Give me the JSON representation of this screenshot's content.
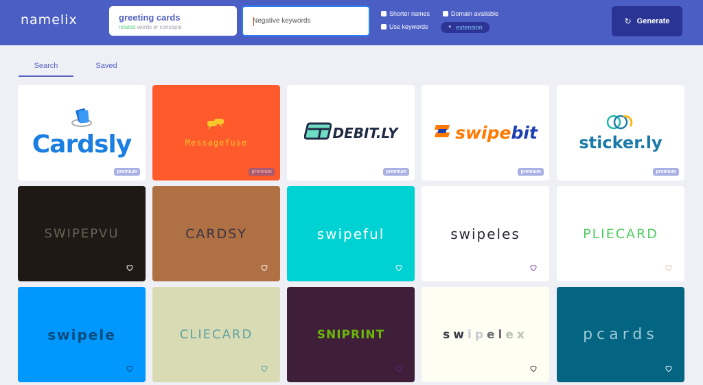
{
  "app": {
    "logo": "namelix",
    "accent_color": "#4b5ec4"
  },
  "search": {
    "keywords_value": "greeting cards",
    "keywords_hint_highlight": "related",
    "keywords_hint_rest": " words or concepts",
    "negative_placeholder": "Negative keywords",
    "negative_value": ""
  },
  "options": {
    "shorter_names": "Shorter names",
    "use_keywords": "Use keywords",
    "domain_available": "Domain available",
    "extension_label": "extension",
    "extension_arrow": "▼"
  },
  "generate": {
    "label": "Generate",
    "icon": "↻"
  },
  "tabs": [
    {
      "label": "Search",
      "active": true
    },
    {
      "label": "Saved",
      "active": false
    }
  ],
  "premium_label": "premium",
  "cards": [
    {
      "name": "Cardsly",
      "bg": "#ffffff",
      "fg": "#1a7fe0",
      "type": "premium",
      "style": "cardsly"
    },
    {
      "name": "Messagefuse",
      "bg": "#ff5a2c",
      "fg": "#f7c72c",
      "type": "premium",
      "style": "messagefuse"
    },
    {
      "name": "DEBIT.LY",
      "bg": "#ffffff",
      "fg": "#1f2a44",
      "type": "premium",
      "style": "debitly"
    },
    {
      "name": "swipebit",
      "name_part1": "swipe",
      "name_part2": "bit",
      "bg": "#ffffff",
      "fg": "#ff7a00",
      "fg2": "#1d3fb0",
      "type": "premium",
      "style": "swipebit"
    },
    {
      "name": "sticker.ly",
      "bg": "#ffffff",
      "fg": "#1a7aa8",
      "type": "premium",
      "style": "stickerly"
    },
    {
      "name": "SWIPEPVU",
      "bg": "#1e1914",
      "fg": "#6e6658",
      "heart": "#ffffff",
      "type": "free",
      "style": "plain-thin"
    },
    {
      "name": "CARDSY",
      "bg": "#af7044",
      "fg": "#3b3442",
      "heart": "#ffffff",
      "type": "free",
      "style": "plain-medium"
    },
    {
      "name": "swipeful",
      "bg": "#00d2d3",
      "fg": "#ffffff",
      "heart": "#ffffff",
      "type": "free",
      "style": "plain-round"
    },
    {
      "name": "swipeles",
      "bg": "#ffffff",
      "fg": "#2a2230",
      "heart": "#8e44ad",
      "type": "free",
      "style": "plain-round"
    },
    {
      "name": "PLIECARD",
      "bg": "#ffffff",
      "fg": "#4ccc5e",
      "heart": "#e8c4a8",
      "type": "free",
      "style": "plain-medium"
    },
    {
      "name": "swipele",
      "bg": "#0098ff",
      "fg": "#0a4a7a",
      "heart": "#0a4a7a",
      "type": "free",
      "style": "plain-bold"
    },
    {
      "name": "CLIECARD",
      "bg": "#d9dbb4",
      "fg": "#5a9ea0",
      "heart": "#5a9ea0",
      "type": "free",
      "style": "plain-thin"
    },
    {
      "name": "SNIPRINT",
      "bg": "#3f1e3a",
      "fg": "#6ab70a",
      "heart": "#5a2a7a",
      "type": "free",
      "style": "plain-heavy"
    },
    {
      "name": "swipelex",
      "letters": [
        "s",
        "w",
        "i",
        "p",
        "e",
        "l",
        "e",
        "x"
      ],
      "letter_colors": [
        "#3a3a46",
        "#3a3a46",
        "#c8c8d0",
        "#c8c8d0",
        "#6a6a72",
        "#6a6a72",
        "#b8c4b0",
        "#b8c4b0"
      ],
      "bg": "#fefff2",
      "fg": "#3a3a46",
      "heart": "#3a3a46",
      "type": "free",
      "style": "multicolor"
    },
    {
      "name": "pcards",
      "bg": "#036582",
      "fg": "#9ecbd8",
      "heart": "#ffffff",
      "type": "free",
      "style": "plain-wide"
    }
  ]
}
